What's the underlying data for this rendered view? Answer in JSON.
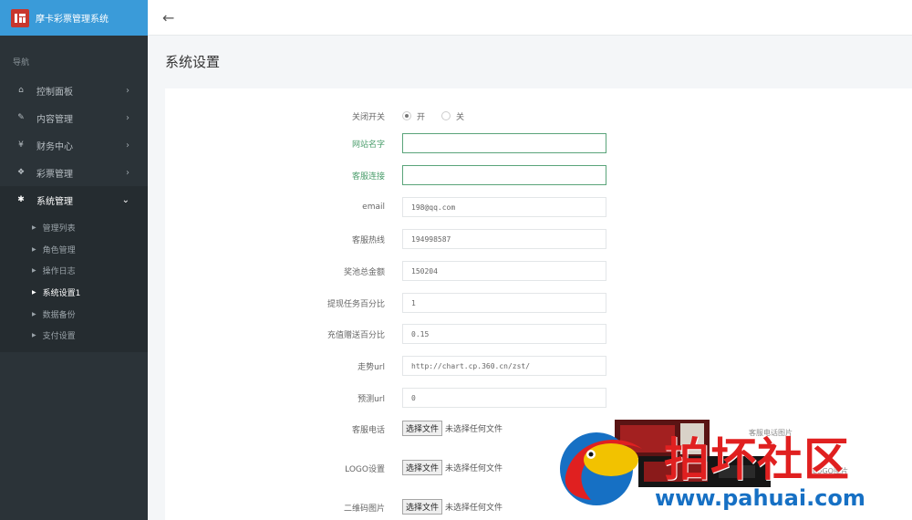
{
  "app": {
    "title": "摩卡彩票管理系统"
  },
  "nav": {
    "caption": "导航",
    "items": [
      {
        "label": "控制面板",
        "icon": "home-icon",
        "glyph": "⌂"
      },
      {
        "label": "内容管理",
        "icon": "edit-icon",
        "glyph": "✎"
      },
      {
        "label": "财务中心",
        "icon": "yen-icon",
        "glyph": "¥"
      },
      {
        "label": "彩票管理",
        "icon": "tag-icon",
        "glyph": "❖"
      },
      {
        "label": "系统管理",
        "icon": "gear-icon",
        "glyph": "✱"
      }
    ],
    "sub_items": [
      {
        "label": "管理列表"
      },
      {
        "label": "角色管理"
      },
      {
        "label": "操作日志"
      },
      {
        "label": "系统设置1"
      },
      {
        "label": "数据备份"
      },
      {
        "label": "支付设置"
      }
    ]
  },
  "page": {
    "title": "系统设置"
  },
  "form": {
    "switch_label": "关闭开关",
    "switch_on": "开",
    "switch_off": "关",
    "site_name_label": "网站名字",
    "site_name_value": "",
    "service_link_label": "客服连接",
    "service_link_value": "",
    "email_label": "email",
    "email_value": "198@qq.com",
    "hotline_label": "客服热线",
    "hotline_value": "194998587",
    "pool_label": "奖池总金额",
    "pool_value": "150204",
    "withdraw_label": "提现任务百分比",
    "withdraw_value": "1",
    "recharge_label": "充值赠送百分比",
    "recharge_value": "0.15",
    "trend_label": "走势url",
    "trend_value": "http://chart.cp.360.cn/zst/",
    "predict_label": "预测url",
    "predict_value": "0",
    "service_phone_label": "客服电话",
    "logo_label": "LOGO设置",
    "qrcode_label": "二维码图片",
    "file_button": "选择文件",
    "file_none": "未选择任何文件",
    "preview_text_1": "客服电话图片",
    "preview_text_2": "LOGO图片"
  },
  "watermark": {
    "title": "拍坏社区",
    "url": "www.pahuai.com"
  },
  "colors": {
    "brand": "#3a9bd9",
    "sidebar": "#2b3338",
    "focus_border": "#5aa47a"
  }
}
